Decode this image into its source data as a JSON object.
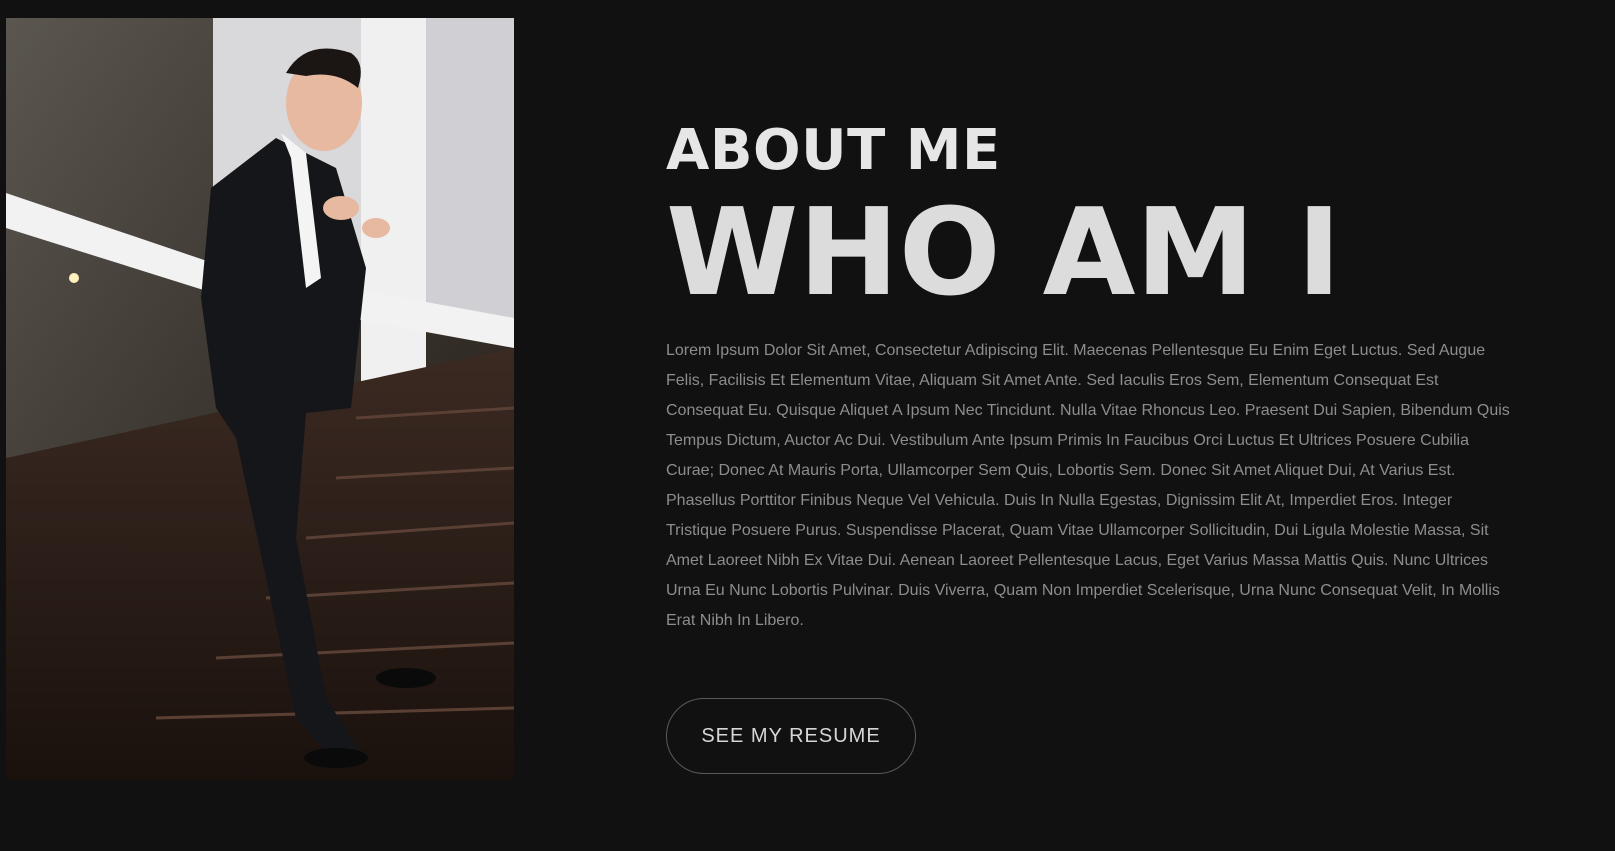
{
  "about": {
    "kicker": "ABOUT ME",
    "headline": "WHO AM I",
    "bio": "Lorem Ipsum Dolor Sit Amet, Consectetur Adipiscing Elit. Maecenas Pellentesque Eu Enim Eget Luctus. Sed Augue Felis, Facilisis Et Elementum Vitae, Aliquam Sit Amet Ante. Sed Iaculis Eros Sem, Elementum Consequat Est Consequat Eu. Quisque Aliquet A Ipsum Nec Tincidunt. Nulla Vitae Rhoncus Leo. Praesent Dui Sapien, Bibendum Quis Tempus Dictum, Auctor Ac Dui. Vestibulum Ante Ipsum Primis In Faucibus Orci Luctus Et Ultrices Posuere Cubilia Curae; Donec At Mauris Porta, Ullamcorper Sem Quis, Lobortis Sem. Donec Sit Amet Aliquet Dui, At Varius Est. Phasellus Porttitor Finibus Neque Vel Vehicula. Duis In Nulla Egestas, Dignissim Elit At, Imperdiet Eros. Integer Tristique Posuere Purus. Suspendisse Placerat, Quam Vitae Ullamcorper Sollicitudin, Dui Ligula Molestie Massa, Sit Amet Laoreet Nibh Ex Vitae Dui. Aenean Laoreet Pellentesque Lacus, Eget Varius Massa Mattis Quis. Nunc Ultrices Urna Eu Nunc Lobortis Pulvinar. Duis Viverra, Quam Non Imperdiet Scelerisque, Urna Nunc Consequat Velit, In Mollis Erat Nibh In Libero.",
    "resume_button": "SEE MY RESUME"
  },
  "colors": {
    "background": "#111111",
    "heading": "#e6e6e6",
    "body_text": "#8d8d8d",
    "button_border": "#5a5a5a"
  }
}
